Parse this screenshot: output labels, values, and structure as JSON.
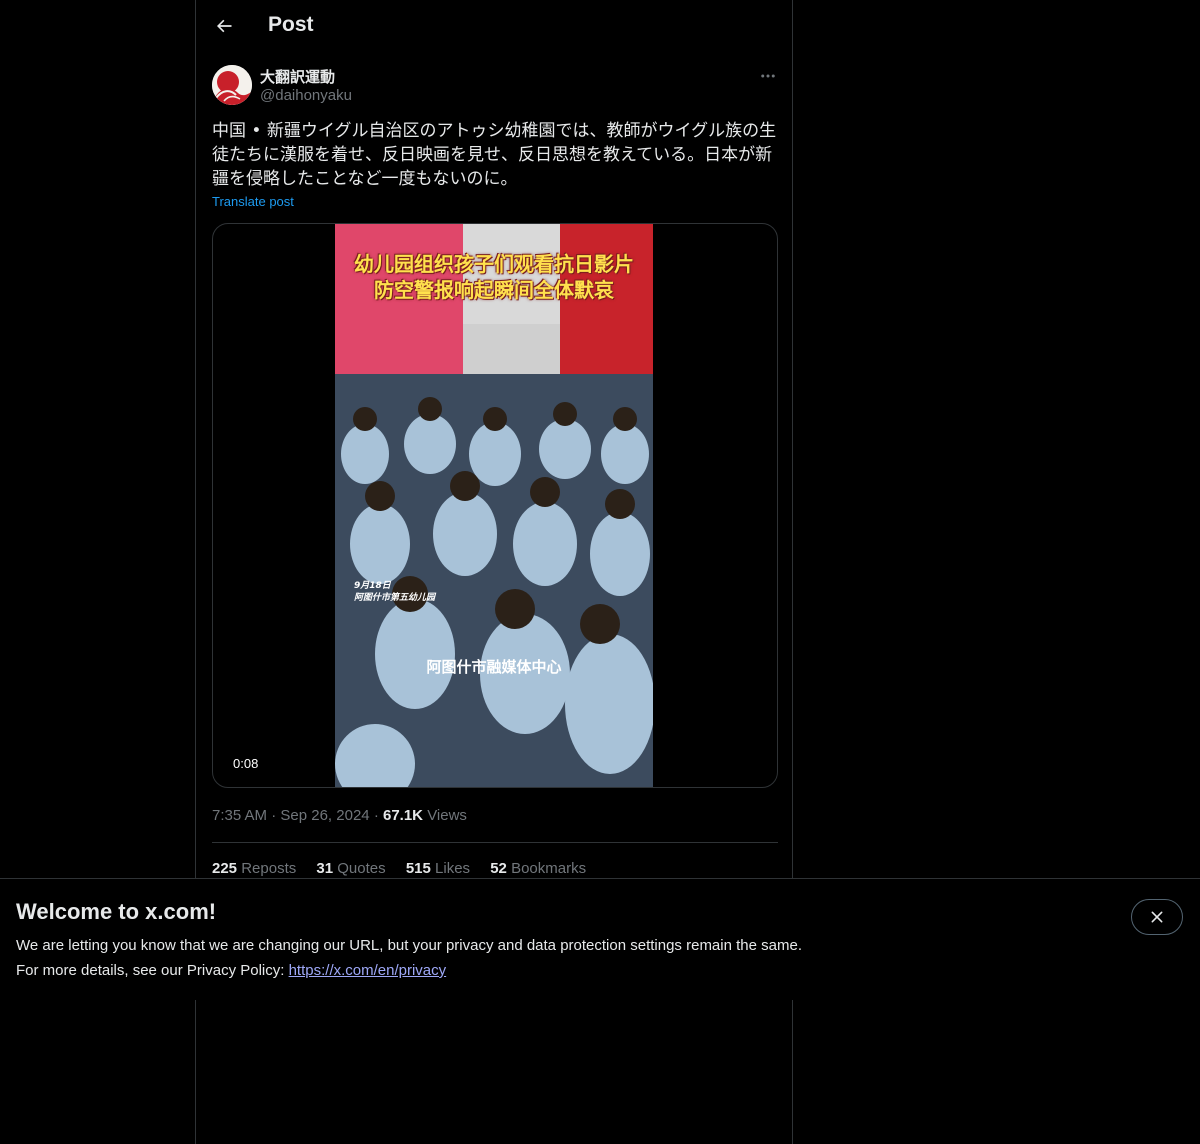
{
  "header": {
    "title": "Post"
  },
  "author": {
    "display_name": "大翻訳運動",
    "handle": "@daihonyaku"
  },
  "post": {
    "text": "中国 • 新疆ウイグル自治区のアトゥシ幼稚園では、教師がウイグル族の生\n徒たちに漢服を着せ、反日映画を見せ、反日思想を教えている。日本が新\n疆を侵略したことなど一度もないのに。",
    "translate_label": "Translate post"
  },
  "media": {
    "duration": "0:08",
    "caption_line1": "幼儿园组织孩子们观看抗日影片",
    "caption_line2": "防空警报响起瞬间全体默哀",
    "overlay_date": "9月18日",
    "overlay_place": "阿图什市第五幼儿园",
    "watermark": "阿图什市融媒体中心"
  },
  "meta": {
    "time": "7:35 AM",
    "date": "Sep 26, 2024",
    "views_count": "67.1K",
    "views_label": "Views"
  },
  "stats": {
    "reposts_count": "225",
    "reposts_label": "Reposts",
    "quotes_count": "31",
    "quotes_label": "Quotes",
    "likes_count": "515",
    "likes_label": "Likes",
    "bookmarks_count": "52",
    "bookmarks_label": "Bookmarks"
  },
  "banner": {
    "title": "Welcome to x.com!",
    "line1": "We are letting you know that we are changing our URL, but your privacy and data protection settings remain the same.",
    "line2_prefix": "For more details, see our Privacy Policy: ",
    "link": "https://x.com/en/privacy"
  },
  "colors": {
    "background": "#000000",
    "text": "#e7e9ea",
    "muted": "#71767b",
    "accent": "#1d9bf0",
    "border": "#2f3336"
  },
  "icons": [
    "arrow-left-icon",
    "more-icon",
    "close-icon"
  ]
}
